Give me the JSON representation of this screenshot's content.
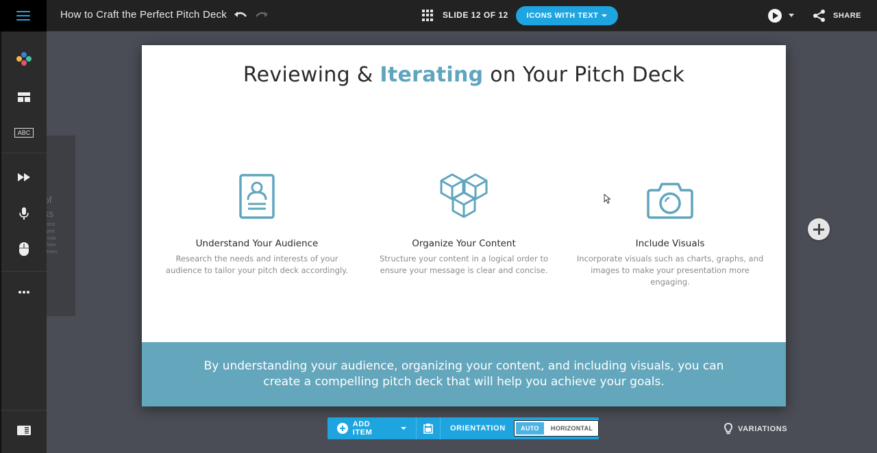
{
  "app": {
    "document_title": "How to Craft the Perfect Pitch Deck",
    "accent_color": "#1ea5e0",
    "slide_accent_color": "#64a7bc"
  },
  "topbar": {
    "menu_icon": "hamburger-menu-icon",
    "undo_icon": "undo-icon",
    "redo_icon": "redo-icon",
    "slides_grid_icon": "grid-icon",
    "slide_counter": "SLIDE 12 OF 12",
    "layout_button_label": "ICONS WITH TEXT",
    "play_icon": "play-icon",
    "share_label": "SHARE"
  },
  "sidebar": {
    "items": [
      {
        "name": "theme-palette",
        "icon": "palette-dots-icon"
      },
      {
        "name": "layout",
        "icon": "layout-icon"
      },
      {
        "name": "text-style",
        "icon": "abc-icon",
        "label": "ABC"
      },
      {
        "name": "animation",
        "icon": "fast-forward-icon"
      },
      {
        "name": "voiceover",
        "icon": "microphone-icon"
      },
      {
        "name": "interactivity",
        "icon": "mouse-icon"
      },
      {
        "name": "more",
        "icon": "more-dots-icon"
      }
    ],
    "bottom_icon": "panel-toggle-icon"
  },
  "ghost_slide": {
    "heading_fragment": "of\nks",
    "body_fragment": "ferent\nped\nuoia\nhem\ntners."
  },
  "slide": {
    "title_before": "Reviewing & ",
    "title_highlight": "Iterating",
    "title_after": " on Your Pitch Deck",
    "columns": [
      {
        "icon": "id-card-person-icon",
        "heading": "Understand Your Audience",
        "body": "Research the needs and interests of your audience to tailor your pitch deck accordingly."
      },
      {
        "icon": "stacked-cubes-icon",
        "heading": "Organize Your Content",
        "body": "Structure your content in a logical order to ensure your message is clear and concise."
      },
      {
        "icon": "camera-icon",
        "heading": "Include Visuals",
        "body": "Incorporate visuals such as charts, graphs, and images to make your presentation more engaging."
      }
    ],
    "banner_text": "By understanding your audience, organizing your content, and including visuals, you can create a compelling pitch deck that will help you achieve your goals."
  },
  "bottom_toolbar": {
    "add_item_label": "ADD ITEM",
    "orientation_label": "ORIENTATION",
    "orientation_options": [
      "AUTO",
      "HORIZONTAL"
    ],
    "orientation_selected": "AUTO"
  },
  "variations_label": "VARIATIONS"
}
